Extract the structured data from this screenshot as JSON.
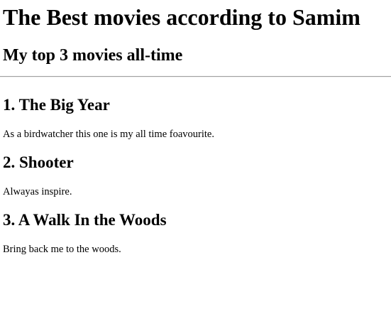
{
  "page": {
    "title": "The Best movies according to Samim",
    "subtitle": "My top 3 movies all-time"
  },
  "movies": [
    {
      "heading": "1. The Big Year",
      "description": "As a birdwatcher this one is my all time foavourite."
    },
    {
      "heading": "2. Shooter",
      "description": "Alwayas inspire."
    },
    {
      "heading": "3. A Walk In the Woods",
      "description": "Bring back me to the woods."
    }
  ]
}
